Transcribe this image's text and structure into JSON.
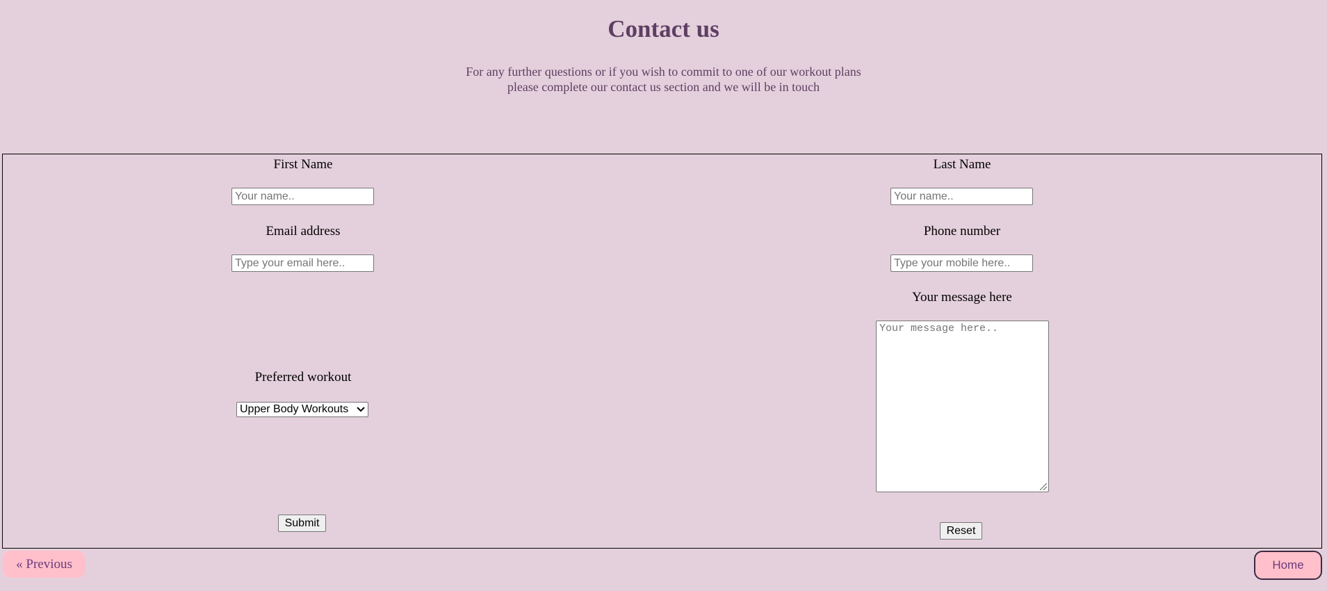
{
  "header": {
    "title": "Contact us",
    "intro_line1": "For any further questions or if you wish to commit to one of our workout plans",
    "intro_line2": "please complete our contact us section and we will be in touch"
  },
  "form": {
    "first_name": {
      "label": "First Name",
      "placeholder": "Your name.."
    },
    "last_name": {
      "label": "Last Name",
      "placeholder": "Your name.."
    },
    "email": {
      "label": "Email address",
      "placeholder": "Type your email here.."
    },
    "phone": {
      "label": "Phone number",
      "placeholder": "Type your mobile here.."
    },
    "message": {
      "label": "Your message here",
      "placeholder": "Your message here.."
    },
    "workout": {
      "label": "Preferred workout",
      "selected": "Upper Body Workouts"
    },
    "submit_label": "Submit",
    "reset_label": "Reset"
  },
  "nav": {
    "previous_label": "« Previous",
    "home_label": "Home"
  },
  "colors": {
    "background": "#e4d0dc",
    "heading": "#5e3f63",
    "nav_button": "#ffc0cb"
  }
}
